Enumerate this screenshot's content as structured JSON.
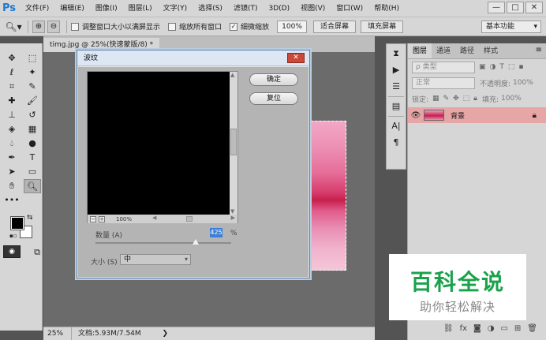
{
  "app": {
    "logo": "Ps"
  },
  "menu": [
    "文件(F)",
    "编辑(E)",
    "图像(I)",
    "图层(L)",
    "文字(Y)",
    "选择(S)",
    "滤镜(T)",
    "3D(D)",
    "视图(V)",
    "窗口(W)",
    "帮助(H)"
  ],
  "window_controls": {
    "minimize": "—",
    "maximize": "□",
    "close": "✕"
  },
  "options": {
    "resize_windows": "调整窗口大小以满屏显示",
    "zoom_all": "缩放所有窗口",
    "scrubby_zoom": "细微缩放",
    "zoom_value": "100%",
    "fit_screen": "适合屏幕",
    "fill_screen": "填充屏幕",
    "workspace": "基本功能"
  },
  "document": {
    "tab": "timg.jpg @ 25%(快速蒙版/8) *",
    "zoom": "25%",
    "doc_info": "文档:5.93M/7.54M"
  },
  "dialog": {
    "title": "波纹",
    "ok": "确定",
    "reset": "复位",
    "preview_zoom": "100%",
    "amount_label": "数量 (A)",
    "amount_value": "425",
    "amount_unit": "%",
    "amount_fraction": 0.74,
    "size_label": "大小 (S)",
    "size_value": "中"
  },
  "layers_panel": {
    "tabs": [
      "图层",
      "通道",
      "路径",
      "样式"
    ],
    "filter_kind": "ρ 类型",
    "blend_mode": "正常",
    "opacity_label": "不透明度:",
    "opacity_value": "100%",
    "lock_label": "锁定:",
    "fill_label": "填充:",
    "fill_value": "100%",
    "layer_name": "背景"
  },
  "watermark": {
    "title": "百科全说",
    "subtitle": "助你轻松解决"
  }
}
